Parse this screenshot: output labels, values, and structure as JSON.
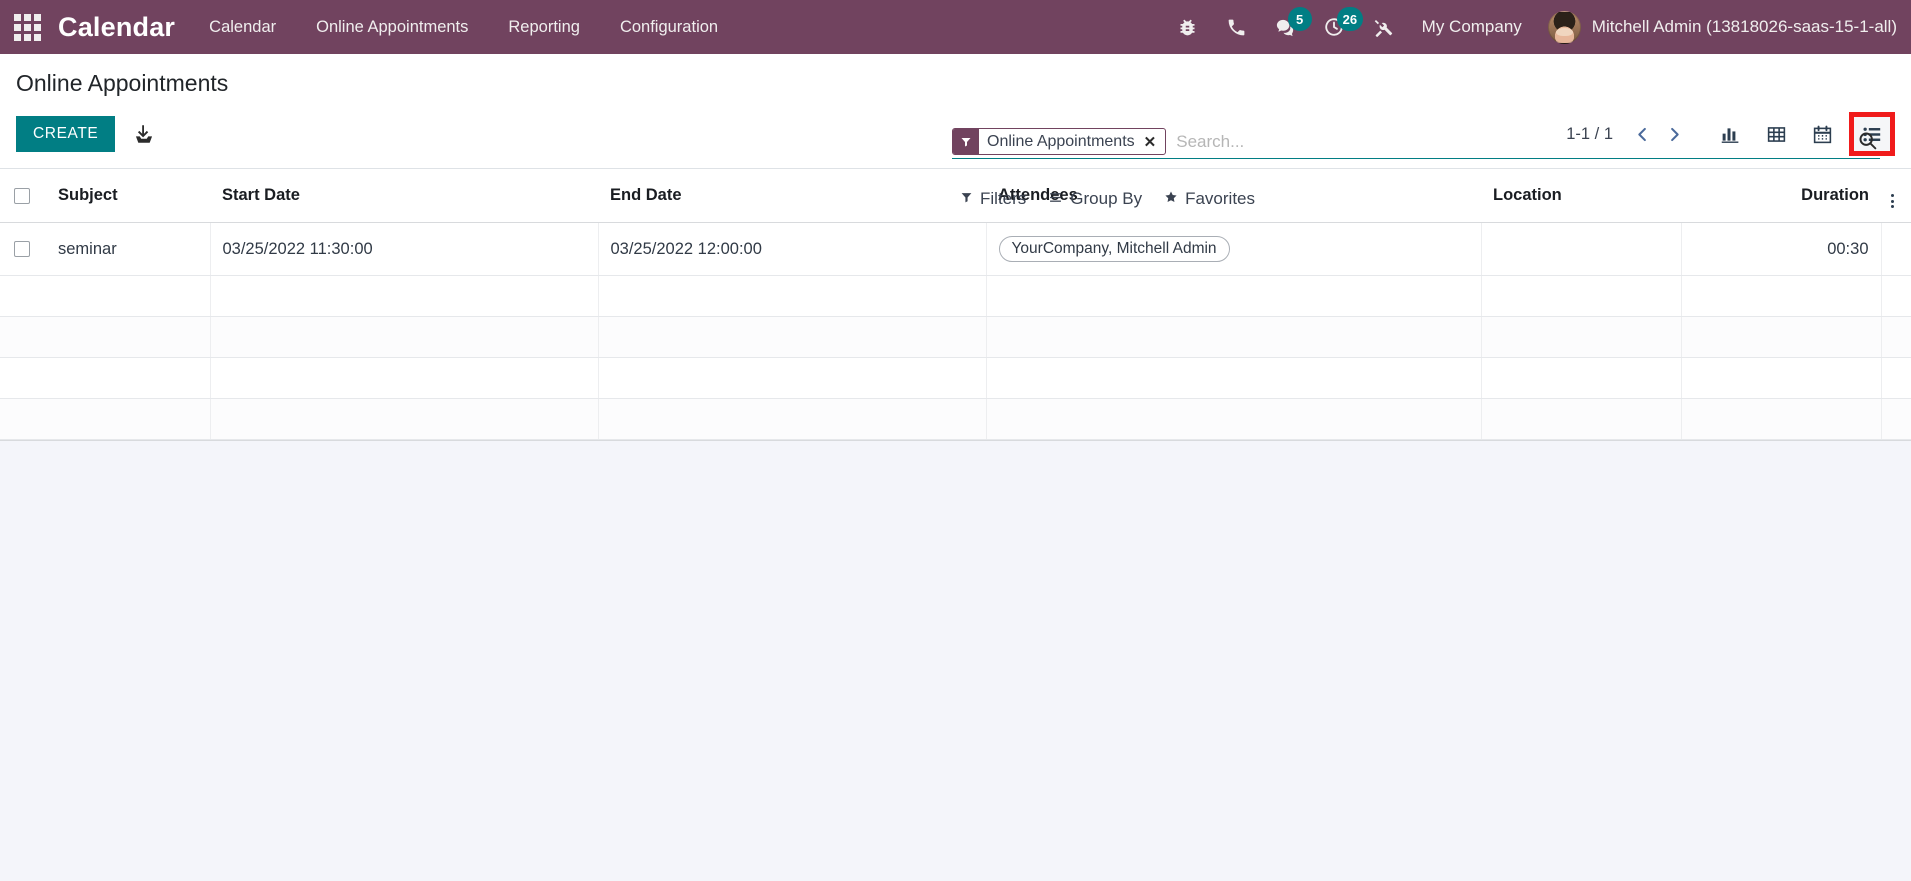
{
  "navbar": {
    "apps_icon": "apps-grid-icon",
    "brand": "Calendar",
    "menu_items": [
      {
        "label": "Calendar"
      },
      {
        "label": "Online Appointments"
      },
      {
        "label": "Reporting"
      },
      {
        "label": "Configuration"
      }
    ],
    "icons": [
      {
        "name": "bug-icon",
        "badge": null
      },
      {
        "name": "phone-icon",
        "badge": null
      },
      {
        "name": "messages-icon",
        "badge": "5"
      },
      {
        "name": "activities-clock-icon",
        "badge": "26"
      },
      {
        "name": "tools-wrench-icon",
        "badge": null
      }
    ],
    "company": "My Company",
    "user": "Mitchell Admin (13818026-saas-15-1-all)",
    "bg_color": "#71435F",
    "badge_color": "#017E84"
  },
  "control_panel": {
    "title": "Online Appointments",
    "create_label": "CREATE",
    "create_color": "#017E84",
    "import_icon": "import-download-icon",
    "search": {
      "facet_label": "Online Appointments",
      "facet_icon": "filter-funnel-icon",
      "facet_close": "×",
      "placeholder": "Search...",
      "value": "",
      "search_icon": "search-icon"
    },
    "dropdowns": [
      {
        "label": "Filters",
        "icon": "filter-funnel-icon"
      },
      {
        "label": "Group By",
        "icon": "group-lines-icon"
      },
      {
        "label": "Favorites",
        "icon": "star-icon"
      }
    ],
    "pager": {
      "count": "1-1 / 1",
      "prev_icon": "chevron-left-icon",
      "next_icon": "chevron-right-icon"
    },
    "views": [
      {
        "name": "graph-view-icon",
        "active": false
      },
      {
        "name": "pivot-view-icon",
        "active": false
      },
      {
        "name": "calendar-view-icon",
        "active": false
      },
      {
        "name": "list-view-icon",
        "active": true
      }
    ],
    "highlight_color": "#F01B1B"
  },
  "list": {
    "columns": [
      {
        "label": "Subject",
        "align": "left"
      },
      {
        "label": "Start Date",
        "align": "left"
      },
      {
        "label": "End Date",
        "align": "left"
      },
      {
        "label": "Attendees",
        "align": "left"
      },
      {
        "label": "Location",
        "align": "left"
      },
      {
        "label": "Duration",
        "align": "right"
      }
    ],
    "optional_columns_icon": "vertical-dots-icon",
    "rows": [
      {
        "subject": "seminar",
        "start_date": "03/25/2022 11:30:00",
        "end_date": "03/25/2022 12:00:00",
        "attendees": "YourCompany, Mitchell Admin",
        "location": "",
        "duration": "00:30"
      }
    ],
    "empty_row_count": 4
  }
}
